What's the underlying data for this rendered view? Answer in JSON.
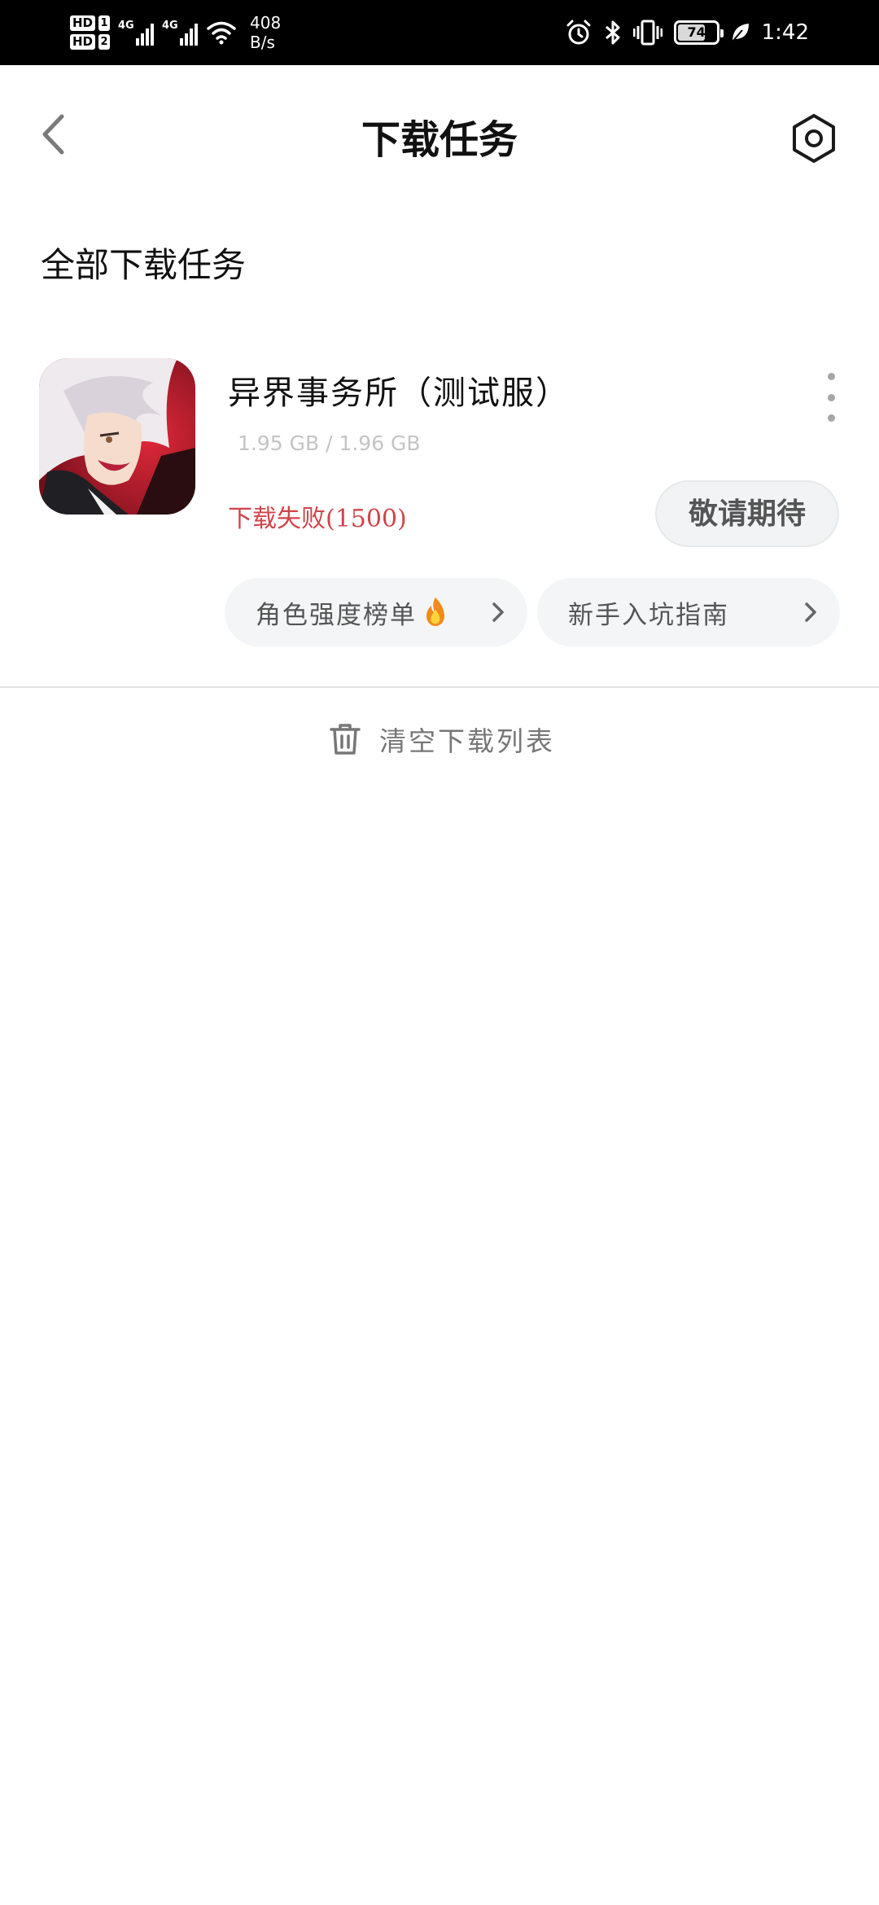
{
  "status_bar": {
    "sim1": "HD",
    "sim1_num": "1",
    "sim2": "HD",
    "sim2_num": "2",
    "network1": "4G",
    "network2": "4G",
    "speed_value": "408",
    "speed_unit": "B/s",
    "battery_level": "74",
    "battery_fraction": 0.74,
    "time": "1:42"
  },
  "header": {
    "title": "下载任务",
    "back_icon": "chevron-left-icon",
    "settings_icon": "hexagon-settings-icon"
  },
  "section": {
    "title": "全部下载任务"
  },
  "task": {
    "app_name": "异界事务所（测试服）",
    "size": "1.95 GB / 1.96 GB",
    "status": "下载失败(1500)",
    "action_label": "敬请期待",
    "status_color": "#d0454b",
    "chips": [
      {
        "label": "角色强度榜单",
        "icon": "fire-icon"
      },
      {
        "label": "新手入坑指南"
      }
    ]
  },
  "footer": {
    "clear_label": "清空下载列表",
    "clear_icon": "trash-icon"
  }
}
